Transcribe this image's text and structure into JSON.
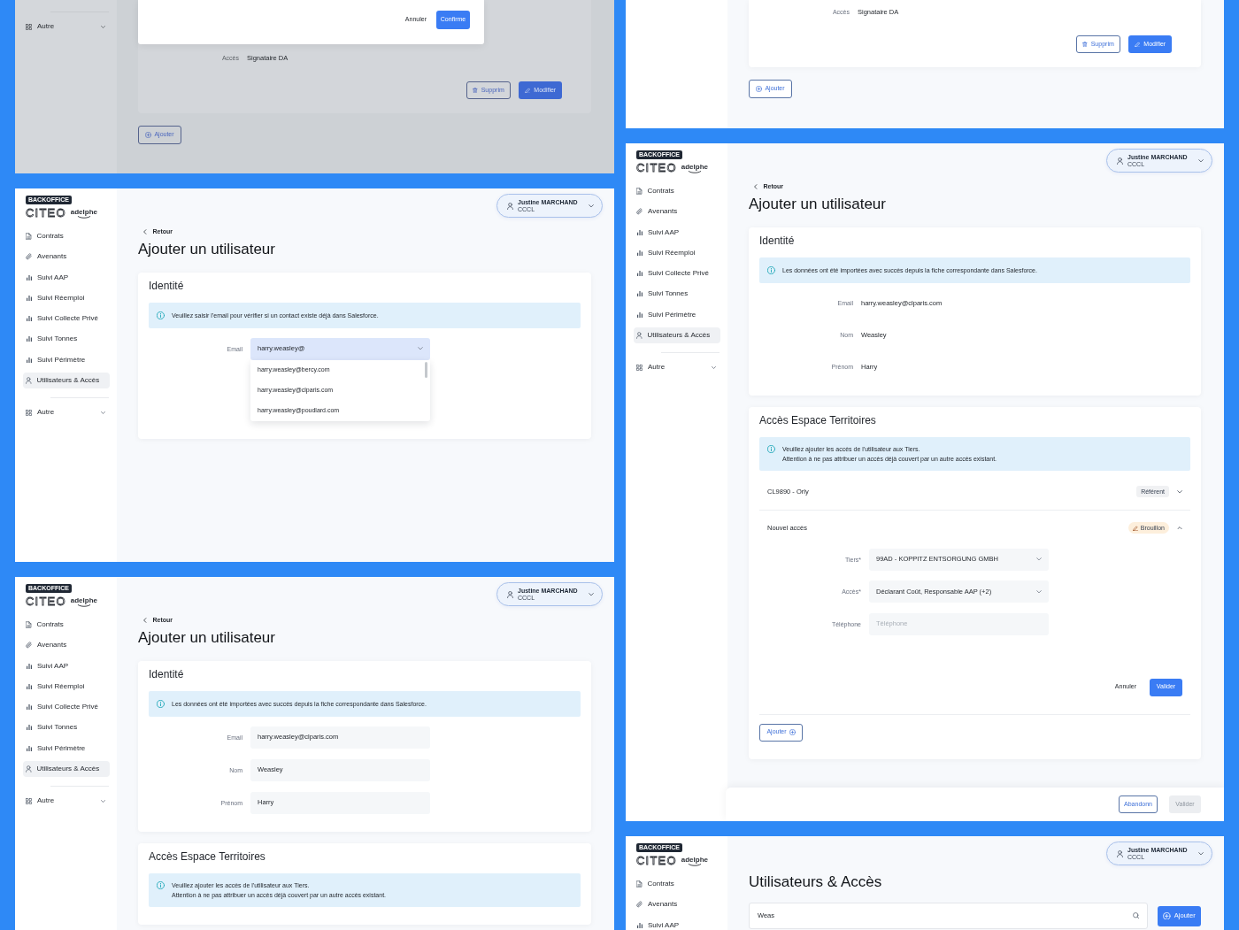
{
  "screens": [
    {
      "kind": "tail",
      "sidebar": {
        "items": [
          {
            "label": "Autre",
            "kind": "group",
            "selected": false,
            "expanded": false
          }
        ]
      },
      "modal": {
        "actions": [
          {
            "label": "Annuler",
            "kind": "text"
          },
          {
            "label": "Confirme",
            "kind": "primary"
          }
        ]
      },
      "detail": {
        "label": "Accès",
        "value": "Signataire DA"
      },
      "actions": [
        {
          "label": "Supprim",
          "kind": "delete"
        },
        {
          "label": "Modifier",
          "kind": "edit"
        }
      ],
      "add_button": {
        "label": "Ajouter",
        "icon_after": false
      }
    },
    {
      "kind": "tail",
      "detail": {
        "label": "Accès",
        "value": "Signataire DA"
      },
      "actions": [
        {
          "label": "Supprim",
          "kind": "delete"
        },
        {
          "label": "Modifier",
          "kind": "edit"
        }
      ],
      "add_button": {
        "label": "Ajouter",
        "icon_after": false
      }
    },
    {
      "kind": "form",
      "sidebar": {
        "logo": {
          "badge": "BACKOFFICE",
          "brand": "CITEO",
          "partner": "adelphe"
        },
        "items": [
          {
            "label": "Contrats",
            "kind": "contracts",
            "selected": false
          },
          {
            "label": "Avenants",
            "kind": "amendments",
            "selected": false
          },
          {
            "label": "Suivi AAP",
            "kind": "report",
            "selected": false
          },
          {
            "label": "Suivi Réemploi",
            "kind": "report",
            "selected": false
          },
          {
            "label": "Suivi Collecte Privé",
            "kind": "report",
            "selected": false
          },
          {
            "label": "Suivi Tonnes",
            "kind": "report",
            "selected": false
          },
          {
            "label": "Suivi Périmètre",
            "kind": "report",
            "selected": false
          },
          {
            "label": "Utilisateurs & Accès",
            "kind": "users",
            "selected": true
          },
          {
            "label": "Autre",
            "kind": "group",
            "selected": false,
            "expanded": false
          }
        ]
      },
      "user": {
        "name": "Justine MARCHAND",
        "org": "CCCL"
      },
      "back_link": "Retour",
      "title": "Ajouter un utilisateur",
      "sections": [
        {
          "title": "Identité",
          "notice": [
            "Veuillez saisir l'email pour vérifier si un contact existe déjà dans Salesforce."
          ],
          "fields": [
            {
              "label": "Email",
              "kind": "combobox",
              "value": "harry.weasley@",
              "focused": true,
              "options": [
                "harry.weasley@bercy.com",
                "harry.weasley@clparis.com",
                "harry.weasley@poudlard.com"
              ]
            }
          ]
        }
      ]
    },
    {
      "kind": "form",
      "sidebar": {
        "logo": {
          "badge": "BACKOFFICE",
          "brand": "CITEO",
          "partner": "adelphe"
        },
        "items": [
          {
            "label": "Contrats",
            "kind": "contracts",
            "selected": false
          },
          {
            "label": "Avenants",
            "kind": "amendments",
            "selected": false
          },
          {
            "label": "Suivi AAP",
            "kind": "report",
            "selected": false
          },
          {
            "label": "Suivi Réemploi",
            "kind": "report",
            "selected": false
          },
          {
            "label": "Suivi Collecte Privé",
            "kind": "report",
            "selected": false
          },
          {
            "label": "Suivi Tonnes",
            "kind": "report",
            "selected": false
          },
          {
            "label": "Suivi Périmètre",
            "kind": "report",
            "selected": false
          },
          {
            "label": "Utilisateurs & Accès",
            "kind": "users",
            "selected": true
          },
          {
            "label": "Autre",
            "kind": "group",
            "selected": false,
            "expanded": false
          }
        ]
      },
      "user": {
        "name": "Justine MARCHAND",
        "org": "CCCL"
      },
      "back_link": "Retour",
      "title": "Ajouter un utilisateur",
      "sections": [
        {
          "title": "Identité",
          "notice": [
            "Les données ont été importées avec succès depuis la fiche correspondante dans Salesforce."
          ],
          "fields": [
            {
              "label": "Email",
              "kind": "readonly",
              "value": "harry.weasley@clparis.com"
            },
            {
              "label": "Nom",
              "kind": "readonly",
              "value": "Weasley"
            },
            {
              "label": "Prénom",
              "kind": "readonly",
              "value": "Harry"
            }
          ]
        },
        {
          "title": "Accès Espace Territoires",
          "notice": [
            "Veuillez ajouter les accès de l'utilisateur aux Tiers.",
            "Attention à ne pas attribuer un accès déjà couvert par un autre accès existant."
          ],
          "accesses": [
            {
              "label": "CL9890 - Orly",
              "badge": {
                "label": "Référent",
                "kind": "role"
              },
              "expanded": false
            },
            {
              "label": "Nouvel accès",
              "badge": {
                "label": "Brouillon",
                "kind": "draft"
              },
              "expanded": true,
              "fields": [
                {
                  "label": "Tiers*",
                  "kind": "select",
                  "value": "99AD - KOPPITZ ENTSORGUNG GMBH"
                },
                {
                  "label": "Accès*",
                  "kind": "select",
                  "value": "Déclarant Coût, Responsable AAP (+2)"
                },
                {
                  "label": "Téléphone",
                  "kind": "text",
                  "placeholder": "Téléphone"
                }
              ],
              "actions": [
                {
                  "label": "Annuler",
                  "kind": "text"
                },
                {
                  "label": "Valider",
                  "kind": "primary"
                }
              ]
            }
          ],
          "add_button": {
            "label": "Ajouter",
            "icon_after": true
          }
        }
      ],
      "footer": {
        "buttons": [
          {
            "label": "Abandonn",
            "kind": "outline",
            "disabled": false
          },
          {
            "label": "Valider",
            "kind": "primary",
            "disabled": true
          }
        ]
      }
    },
    {
      "kind": "form",
      "sidebar": {
        "logo": {
          "badge": "BACKOFFICE",
          "brand": "CITEO",
          "partner": "adelphe"
        },
        "items": [
          {
            "label": "Contrats",
            "kind": "contracts",
            "selected": false
          },
          {
            "label": "Avenants",
            "kind": "amendments",
            "selected": false
          },
          {
            "label": "Suivi AAP",
            "kind": "report",
            "selected": false
          },
          {
            "label": "Suivi Réemploi",
            "kind": "report",
            "selected": false
          },
          {
            "label": "Suivi Collecte Privé",
            "kind": "report",
            "selected": false
          },
          {
            "label": "Suivi Tonnes",
            "kind": "report",
            "selected": false
          },
          {
            "label": "Suivi Périmètre",
            "kind": "report",
            "selected": false
          },
          {
            "label": "Utilisateurs & Accès",
            "kind": "users",
            "selected": true
          },
          {
            "label": "Autre",
            "kind": "group",
            "selected": false,
            "expanded": false
          }
        ]
      },
      "user": {
        "name": "Justine MARCHAND",
        "org": "CCCL"
      },
      "back_link": "Retour",
      "title": "Ajouter un utilisateur",
      "sections": [
        {
          "title": "Identité",
          "notice": [
            "Les données ont été importées avec succès depuis la fiche correspondante dans Salesforce."
          ],
          "fields": [
            {
              "label": "Email",
              "kind": "text",
              "value": "harry.weasley@clparis.com"
            },
            {
              "label": "Nom",
              "kind": "text",
              "value": "Weasley"
            },
            {
              "label": "Prénom",
              "kind": "text",
              "value": "Harry"
            }
          ]
        },
        {
          "title": "Accès Espace Territoires",
          "notice": [
            "Veuillez ajouter les accès de l'utilisateur aux Tiers.",
            "Attention à ne pas attribuer un accès déjà couvert par un autre accès existant."
          ]
        }
      ]
    },
    {
      "kind": "list",
      "sidebar": {
        "logo": {
          "badge": "BACKOFFICE",
          "brand": "CITEO",
          "partner": "adelphe"
        },
        "items": [
          {
            "label": "Contrats",
            "kind": "contracts",
            "selected": false
          },
          {
            "label": "Avenants",
            "kind": "amendments",
            "selected": false
          },
          {
            "label": "Suivi AAP",
            "kind": "report",
            "selected": false
          }
        ]
      },
      "user": {
        "name": "Justine MARCHAND",
        "org": "CCCL"
      },
      "title": "Utilisateurs & Accès",
      "search": {
        "value": "Weas"
      },
      "add_button": {
        "label": "Ajouter",
        "icon_after": false
      }
    }
  ]
}
